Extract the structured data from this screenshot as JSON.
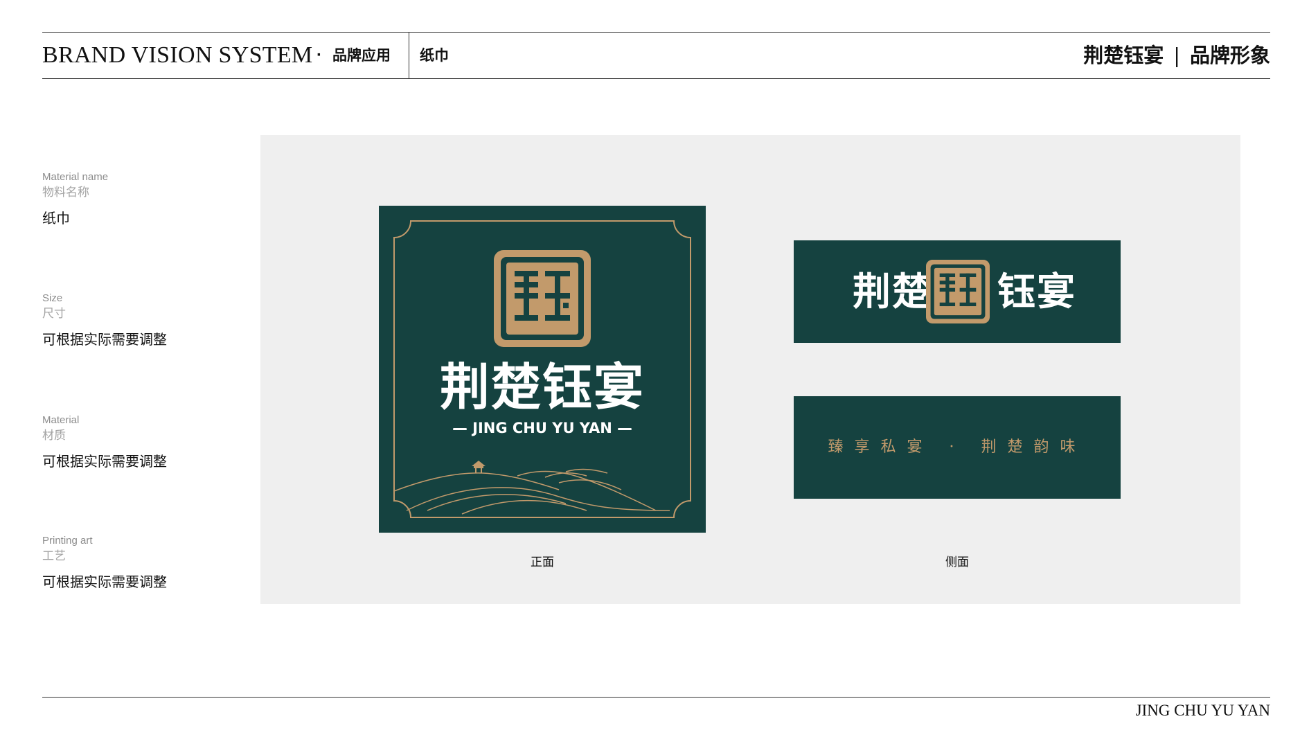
{
  "header": {
    "brand_title": "BRAND VISION SYSTEM",
    "separator": "·",
    "section": "品牌应用",
    "topic": "纸巾",
    "right_brand": "荆楚钰宴",
    "right_divider": "|",
    "right_label": "品牌形象"
  },
  "info": [
    {
      "en": "Material name",
      "cn": "物料名称",
      "value": "纸巾"
    },
    {
      "en": "Size",
      "cn": "尺寸",
      "value": "可根据实际需要调整"
    },
    {
      "en": "Material",
      "cn": "材质",
      "value": "可根据实际需要调整"
    },
    {
      "en": "Printing art",
      "cn": "工艺",
      "value": "可根据实际需要调整"
    }
  ],
  "mockups": {
    "front": {
      "brand_cn": "荆楚钰宴",
      "brand_en": "JING CHU YU YAN",
      "caption": "正面"
    },
    "side": {
      "left_text": "荆楚",
      "right_text": "钰宴",
      "slogan": "臻享私宴 · 荆楚韵味",
      "caption": "侧面"
    }
  },
  "colors": {
    "napkin_green": "#154240",
    "gold": "#c29a6b",
    "stage_gray": "#efefef"
  },
  "footer": {
    "text": "JING CHU YU YAN"
  }
}
